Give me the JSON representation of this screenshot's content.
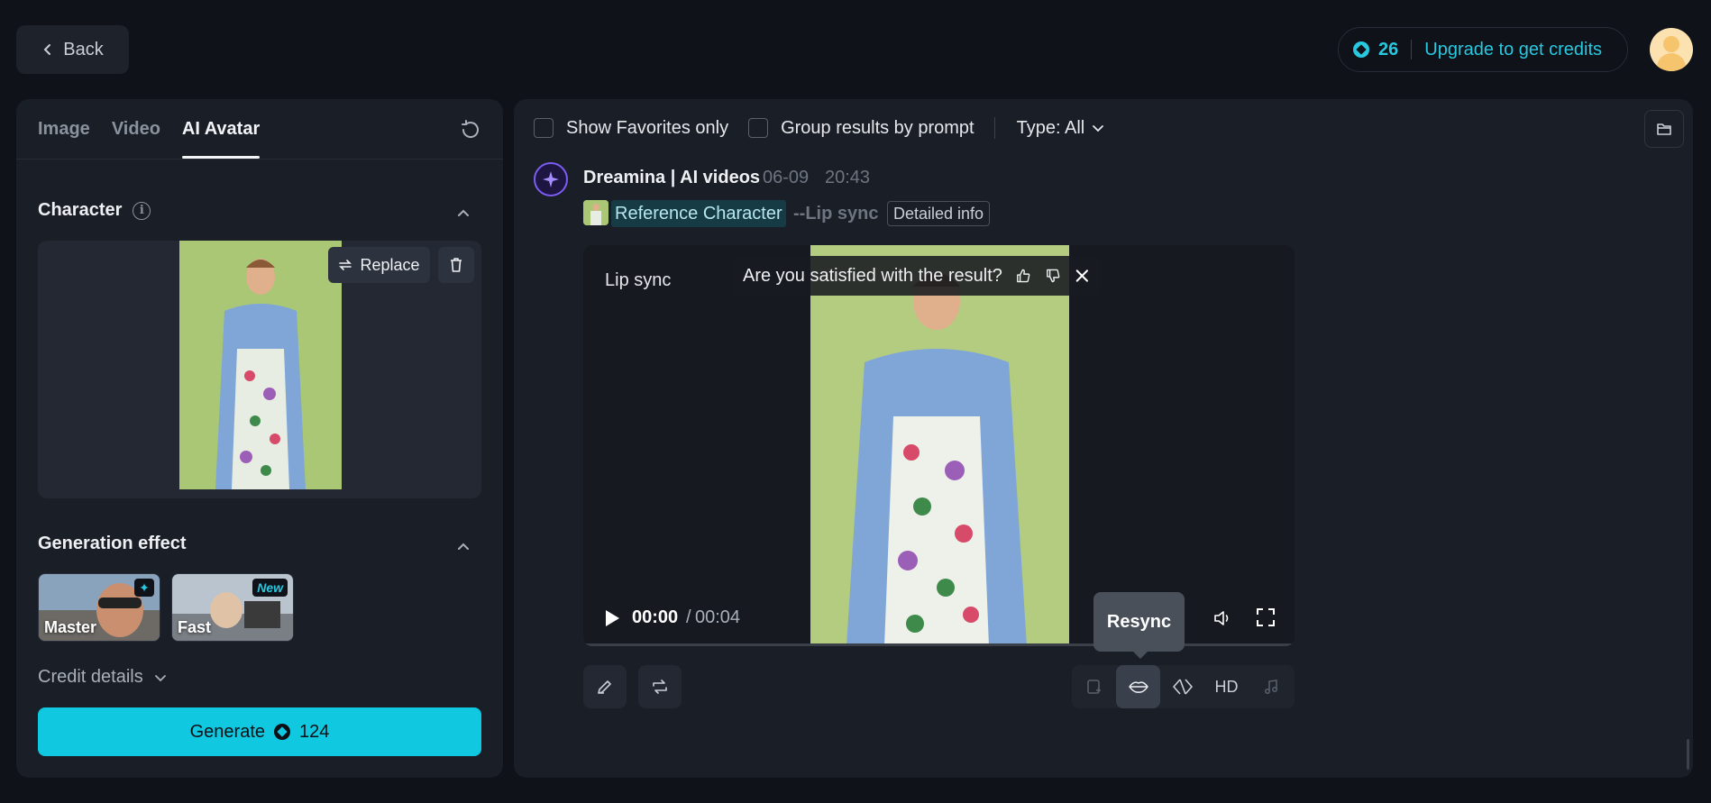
{
  "header": {
    "back_label": "Back",
    "credits": "26",
    "upgrade_label": "Upgrade to get credits"
  },
  "left_panel": {
    "tabs": [
      {
        "label": "Image"
      },
      {
        "label": "Video"
      },
      {
        "label": "AI Avatar"
      }
    ],
    "active_tab": "AI Avatar",
    "character": {
      "title": "Character",
      "replace_label": "Replace"
    },
    "generation_effect": {
      "title": "Generation effect",
      "options": [
        {
          "label": "Master",
          "badge": "✦"
        },
        {
          "label": "Fast",
          "badge": "New"
        }
      ]
    },
    "credit_details_label": "Credit details",
    "generate": {
      "label": "Generate",
      "cost": "124"
    }
  },
  "main_panel": {
    "filters": {
      "favorites_label": "Show Favorites only",
      "group_label": "Group results by prompt",
      "type_label": "Type: All"
    },
    "result": {
      "source": "Dreamina | AI videos",
      "date": "06-09",
      "time": "20:43",
      "reference_label": "Reference Character",
      "mode_tag": "--Lip sync",
      "detail_label": "Detailed info",
      "video": {
        "label": "Lip sync",
        "feedback_question": "Are you satisfied with the result?",
        "current_time": "00:00",
        "separator": "/",
        "total_time": "00:04",
        "progress": 0
      },
      "tooltip": "Resync",
      "tools": [
        "extend-icon",
        "lip-icon",
        "interpolate-icon",
        "HD",
        "music-icon"
      ]
    }
  },
  "colors": {
    "accent": "#10c9e0",
    "background": "#0f1218",
    "panel": "#1a1e26"
  }
}
